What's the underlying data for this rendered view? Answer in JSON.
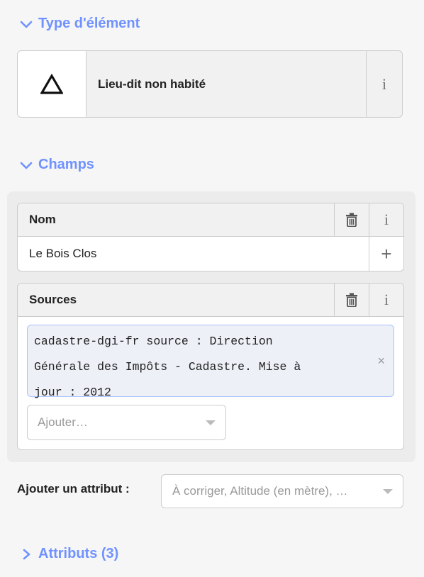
{
  "preset_section": {
    "header": "Type d'élément",
    "preset_name": "Lieu-dit non habité",
    "info_label": "i",
    "icon": "triangle-outline-icon"
  },
  "fields_section": {
    "header": "Champs"
  },
  "name_field": {
    "label": "Nom",
    "value": "Le Bois Clos",
    "info_label": "i",
    "add_label": "+"
  },
  "sources_field": {
    "label": "Sources",
    "info_label": "i",
    "chip_lines": [
      "cadastre-dgi-fr source : Direction",
      "Générale des Impôts - Cadastre. Mise à",
      "jour : 2012"
    ],
    "chip_remove": "×",
    "combo_placeholder": "Ajouter…"
  },
  "add_attribute": {
    "label": "Ajouter un attribut :",
    "placeholder": "À corriger, Altitude (en mètre), …"
  },
  "attributes_section": {
    "header": "Attributs (3)"
  },
  "colors": {
    "accent": "#7092ff",
    "panel_bg": "#f6f6f6",
    "field_header_bg": "#f1f1f1",
    "chip_bg": "#eef0f7",
    "chip_border": "#a9c1ff"
  }
}
